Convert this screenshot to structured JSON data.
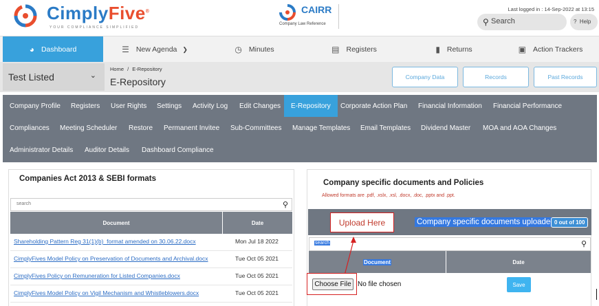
{
  "brand": {
    "name_part1": "Cimply",
    "name_part2": "Five",
    "tagline": "YOUR COMPLIANCE SIMPLIFIED",
    "partner_name": "CAIRR",
    "partner_subtitle": "Company Law Reference",
    "colors": {
      "blue": "#2b7bc6",
      "orange": "#e94e2e",
      "accent": "#38a1dc",
      "nav_gray": "#6f7782"
    }
  },
  "header": {
    "last_logged_in": "Last logged in : 14-Sep-2022 at 13:15",
    "search_label": "Search",
    "help_label": "Help"
  },
  "main_nav": [
    {
      "label": "Dashboard",
      "icon": "dashboard-icon",
      "active": true
    },
    {
      "label": "New Agenda",
      "icon": "list-icon",
      "active": false
    },
    {
      "label": "Minutes",
      "icon": "clock-icon",
      "active": false
    },
    {
      "label": "Registers",
      "icon": "register-icon",
      "active": false
    },
    {
      "label": "Returns",
      "icon": "document-icon",
      "active": false
    },
    {
      "label": "Action Trackers",
      "icon": "tracker-icon",
      "active": false
    }
  ],
  "company": {
    "selected": "Test Listed",
    "breadcrumb_home": "Home",
    "breadcrumb_sep": "/",
    "breadcrumb_current": "E-Repository",
    "page_title": "E-Repository",
    "buttons": [
      "Company Data",
      "Records",
      "Past Records"
    ]
  },
  "sub_nav": {
    "row1": [
      "Company Profile",
      "Registers",
      "User Rights",
      "Settings",
      "Activity Log",
      "Edit Changes",
      "E-Repository",
      "Corporate Action Plan",
      "Financial Information",
      "Financial Performance"
    ],
    "row2": [
      "Compliances",
      "Meeting Scheduler",
      "Restore",
      "Permanent Invitee",
      "Sub-Committees",
      "Manage Templates",
      "Email Templates",
      "Dividend Master",
      "MOA and AOA Changes"
    ],
    "row3": [
      "Administrator Details",
      "Auditor Details",
      "Dashboard Compliance"
    ],
    "active": "E-Repository"
  },
  "left_panel": {
    "title": "Companies Act 2013 & SEBI formats",
    "search_placeholder": "search",
    "columns": [
      "Document",
      "Date"
    ],
    "rows": [
      {
        "document": "Shareholding Pattern Reg 31(1)(b)_format amended on 30.06.22.docx",
        "date": "Mon Jul 18 2022"
      },
      {
        "document": "CimplyFives Model Policy on Preservation of Documents and Archival.docx",
        "date": "Tue Oct 05 2021"
      },
      {
        "document": "CimplyFives Policy on Remuneration for Listed Companies.docx",
        "date": "Tue Oct 05 2021"
      },
      {
        "document": "CimplyFives Model Policy on Vigil Mechanism and Whistleblowers.docx",
        "date": "Tue Oct 05 2021"
      }
    ]
  },
  "right_panel": {
    "title": "Company specific documents and Policies",
    "allowed_formats": "Allowed formats are .pdf, .xslx, .xsl, .docx, .doc, .pptx and .ppt.",
    "upload_annotation": "Upload Here",
    "uploaded_label": "Company specific documents uploaded :",
    "uploaded_count": "0 out of 100",
    "search_placeholder": "search",
    "columns": [
      "Document",
      "Date"
    ],
    "choose_file_label": "Choose File",
    "no_file_text": "No file chosen",
    "save_label": "Save"
  }
}
